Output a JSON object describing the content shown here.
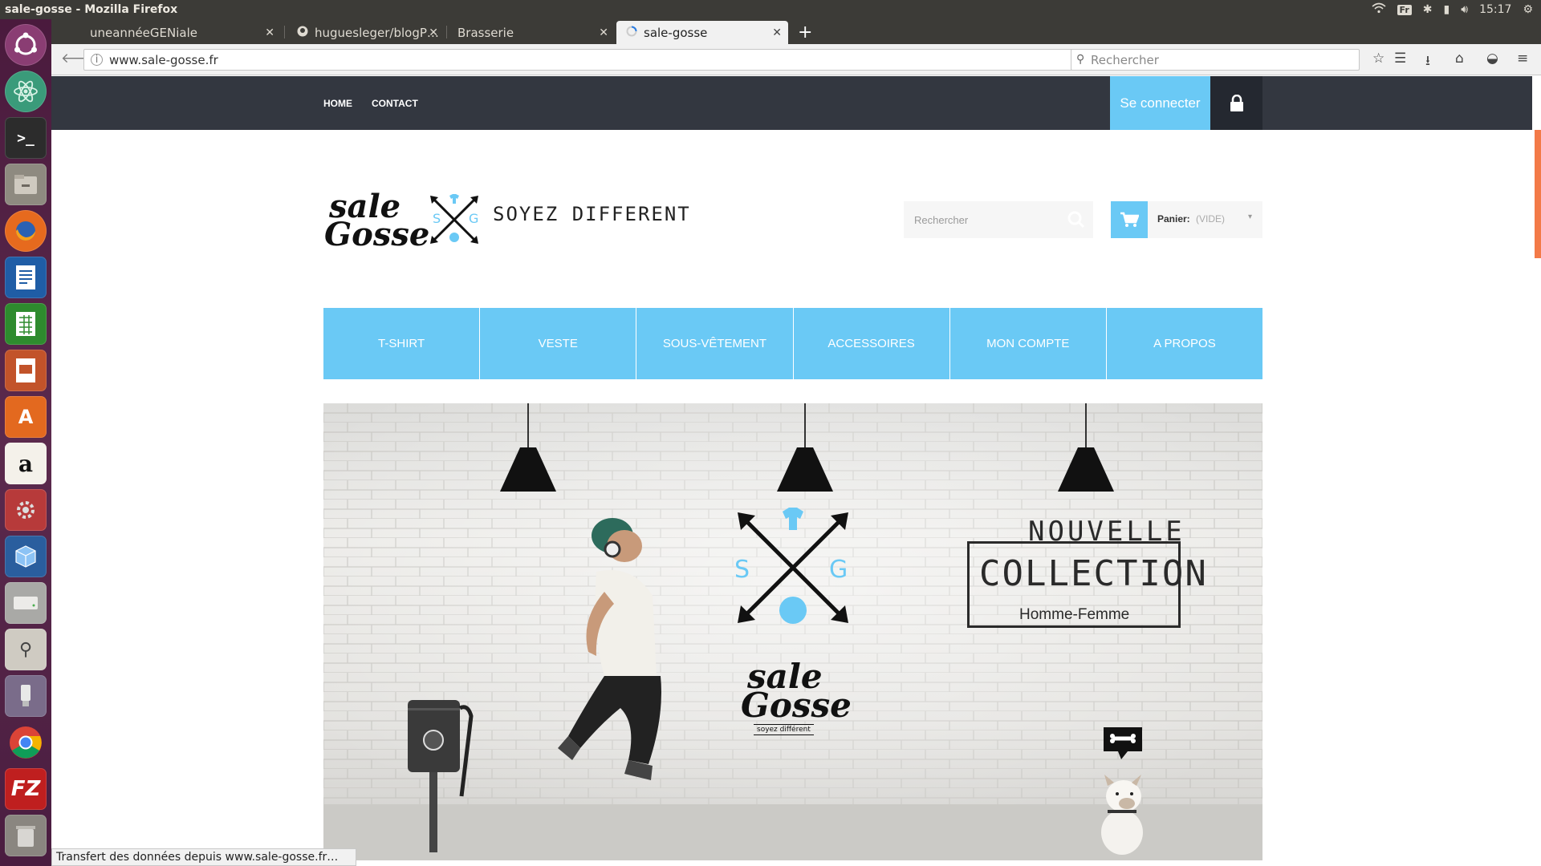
{
  "os": {
    "window_title": "sale-gosse - Mozilla Firefox",
    "keyboard": "Fr",
    "clock": "15:17",
    "launcher_icons": [
      "ubuntu-icon",
      "atom-icon",
      "terminal-icon",
      "files-icon",
      "firefox-icon",
      "writer-icon",
      "calc-icon",
      "impress-icon",
      "software-center-icon",
      "amazon-icon",
      "settings-icon",
      "virtualbox-icon",
      "drive-icon",
      "scanner-icon",
      "usb-icon",
      "chrome-icon",
      "filezilla-icon",
      "trash-icon"
    ]
  },
  "browser": {
    "tabs": [
      {
        "label": "uneannéeGENiale",
        "active": false
      },
      {
        "label": "huguesleger/blogP…",
        "active": false
      },
      {
        "label": "Brasserie",
        "active": false
      },
      {
        "label": "sale-gosse",
        "active": true
      }
    ],
    "new_tab": "+",
    "url": "www.sale-gosse.fr",
    "search_placeholder": "Rechercher",
    "status": "Transfert des données depuis www.sale-gosse.fr…"
  },
  "site": {
    "top_nav": [
      "HOME",
      "CONTACT"
    ],
    "login_label": "Se connecter",
    "logo_line1": "sale",
    "logo_line2": "Gosse",
    "logo_letters": [
      "S",
      "G"
    ],
    "slogan": "SOYEZ DIFFERENT",
    "search_placeholder": "Rechercher",
    "cart_label": "Panier:",
    "cart_status": "(VIDE)",
    "menu": [
      "T-SHIRT",
      "VESTE",
      "SOUS-VÊTEMENT",
      "ACCESSOIRES",
      "MON COMPTE",
      "A PROPOS"
    ],
    "banner": {
      "headline": "NOUVELLE",
      "collection": "COLLECTION",
      "sub": "Homme-Femme",
      "logo_line1": "sale",
      "logo_line2": "Gosse",
      "logo_tagline": "soyez différent"
    },
    "accent_color": "#6ac9f5",
    "header_color": "#333740"
  }
}
